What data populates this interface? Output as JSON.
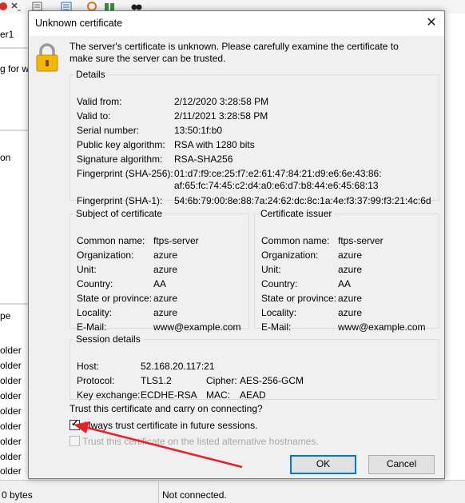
{
  "background": {
    "left_pane_texts": [
      "er1",
      "g for w",
      "on",
      "pe",
      "older",
      "older",
      "older",
      "older",
      "older",
      "older",
      "older",
      "older",
      "older"
    ],
    "status_left": "0 bytes",
    "status_right": "Not connected."
  },
  "dialog": {
    "title": "Unknown certificate",
    "close_glyph": "✕",
    "intro": "The server's certificate is unknown. Please carefully examine the certificate to make sure the server can be trusted.",
    "details": {
      "legend": "Details",
      "rows": [
        {
          "label": "Valid from:",
          "value": "2/12/2020 3:28:58 PM"
        },
        {
          "label": "Valid to:",
          "value": "2/11/2021 3:28:58 PM"
        },
        {
          "label": "Serial number:",
          "value": "13:50:1f:b0"
        },
        {
          "label": "Public key algorithm:",
          "value": "RSA with 1280 bits"
        },
        {
          "label": "Signature algorithm:",
          "value": "RSA-SHA256"
        },
        {
          "label": "Fingerprint (SHA-256):",
          "value": "01:d7:f9:ce:25:f7:e2:61:47:84:21:d9:e6:6e:43:86:",
          "value2": "af:65:fc:74:45:c2:d4:a0:e6:d7:b8:44:e6:45:68:13"
        },
        {
          "label": "Fingerprint (SHA-1):",
          "value": "54:6b:79:00:8e:88:7a:24:62:dc:8c:1a:4e:f3:37:99:f3:21:4c:6d"
        }
      ]
    },
    "subject": {
      "legend": "Subject of certificate",
      "rows": [
        {
          "label": "Common name:",
          "value": "ftps-server"
        },
        {
          "label": "Organization:",
          "value": "azure"
        },
        {
          "label": "Unit:",
          "value": "azure"
        },
        {
          "label": "Country:",
          "value": "AA"
        },
        {
          "label": "State or province:",
          "value": "azure"
        },
        {
          "label": "Locality:",
          "value": "azure"
        },
        {
          "label": "E-Mail:",
          "value": "www@example.com"
        }
      ]
    },
    "issuer": {
      "legend": "Certificate issuer",
      "rows": [
        {
          "label": "Common name:",
          "value": "ftps-server"
        },
        {
          "label": "Organization:",
          "value": "azure"
        },
        {
          "label": "Unit:",
          "value": "azure"
        },
        {
          "label": "Country:",
          "value": "AA"
        },
        {
          "label": "State or province:",
          "value": "azure"
        },
        {
          "label": "Locality:",
          "value": "azure"
        },
        {
          "label": "E-Mail:",
          "value": "www@example.com"
        }
      ]
    },
    "session": {
      "legend": "Session details",
      "host_label": "Host:",
      "host": "52.168.20.117:21",
      "protocol_label": "Protocol:",
      "protocol": "TLS1.2",
      "cipher_label": "Cipher:",
      "cipher": "AES-256-GCM",
      "kex_label": "Key exchange:",
      "kex": "ECDHE-RSA",
      "mac_label": "MAC:",
      "mac": "AEAD"
    },
    "trust_question": "Trust this certificate and carry on connecting?",
    "always_trust": {
      "label": "Always trust certificate in future sessions.",
      "checked": true
    },
    "alt_hostnames": {
      "label": "Trust this certificate on the listed alternative hostnames.",
      "checked": false,
      "disabled": true
    },
    "ok_label": "OK",
    "cancel_label": "Cancel"
  },
  "annotation": {
    "arrow_color": "#e8202a"
  }
}
